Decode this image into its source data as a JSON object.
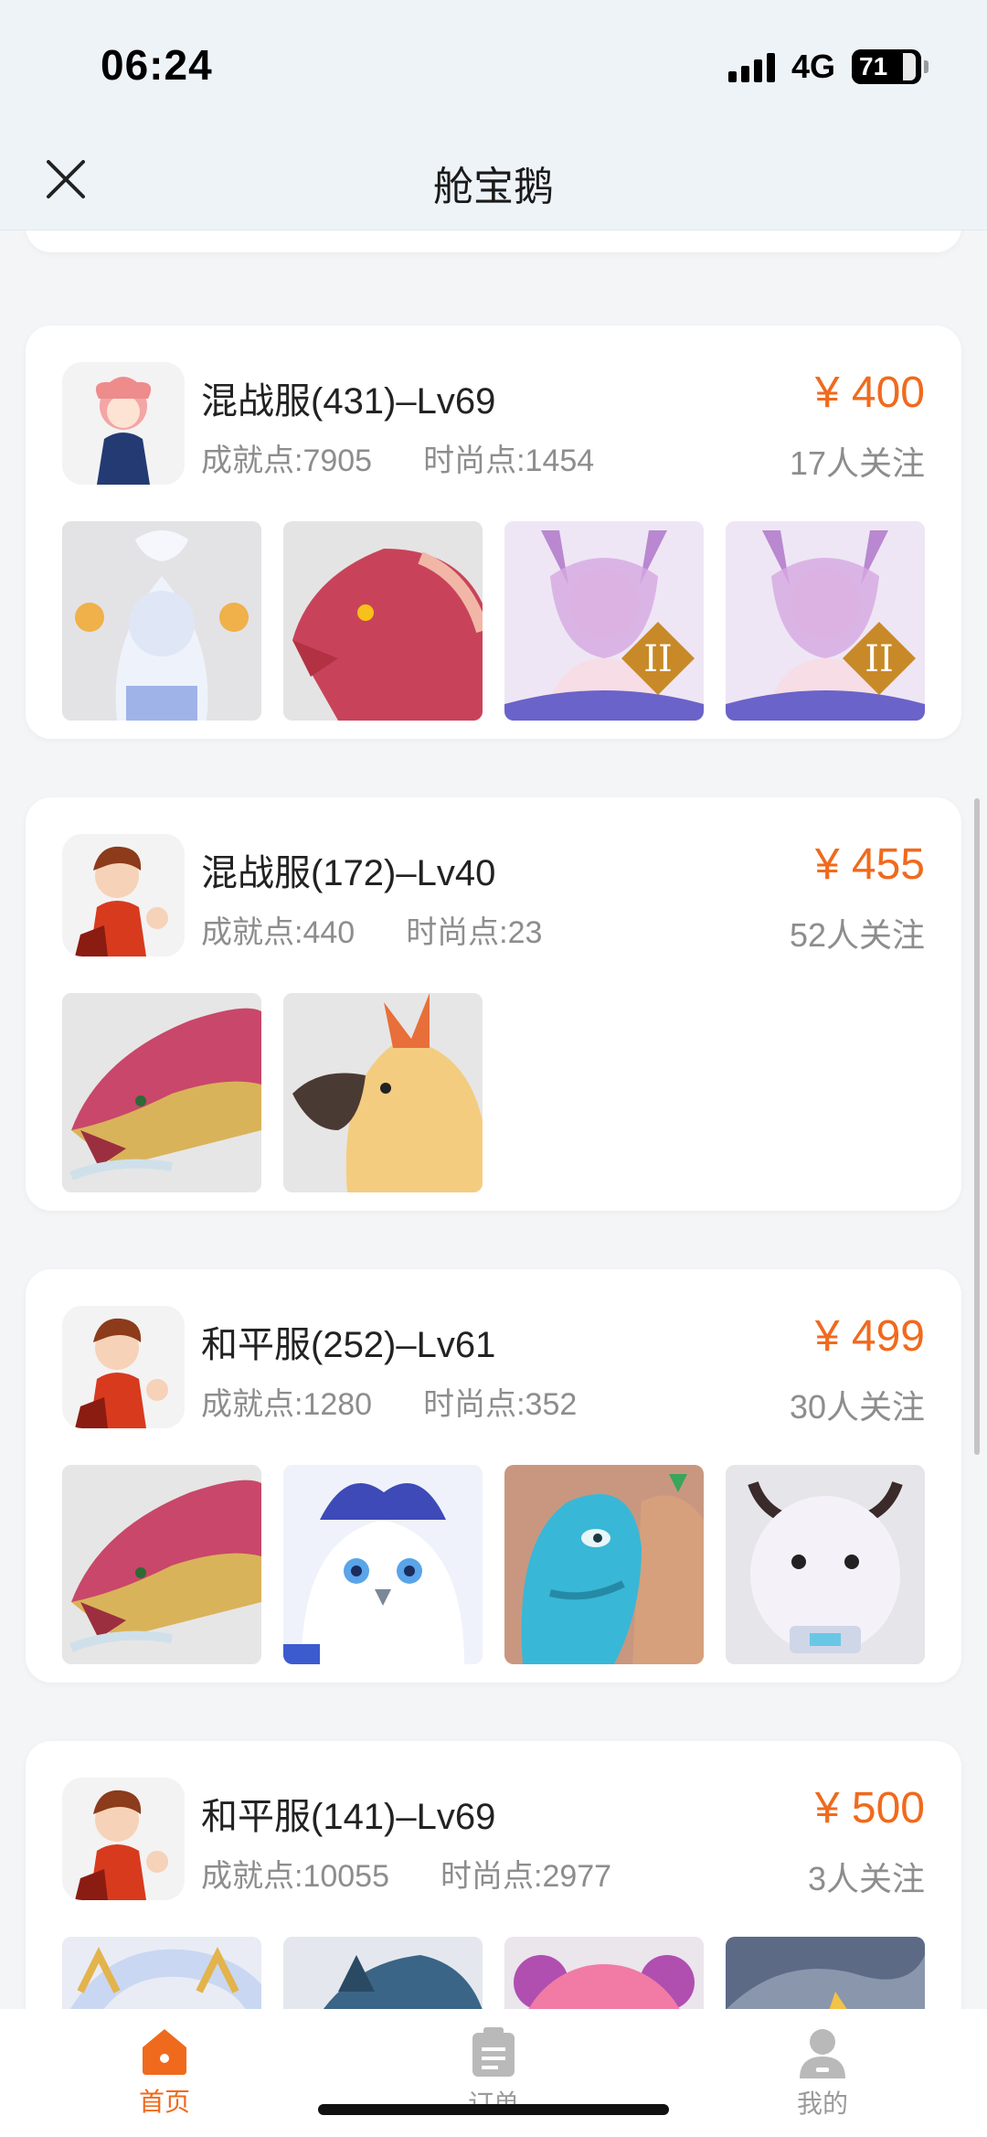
{
  "status": {
    "time": "06:24",
    "network": "4G",
    "battery": "71",
    "battery_level": 0.71
  },
  "nav": {
    "title": "舱宝鹅"
  },
  "listings": [
    {
      "server": "混战服(431)–Lv69",
      "achievement": "成就点:7905",
      "fashion": "时尚点:1454",
      "price": "¥ 400",
      "followers": "17人关注"
    },
    {
      "server": "混战服(172)–Lv40",
      "achievement": "成就点:440",
      "fashion": "时尚点:23",
      "price": "¥ 455",
      "followers": "52人关注"
    },
    {
      "server": "和平服(252)–Lv61",
      "achievement": "成就点:1280",
      "fashion": "时尚点:352",
      "price": "¥ 499",
      "followers": "30人关注"
    },
    {
      "server": "和平服(141)–Lv69",
      "achievement": "成就点:10055",
      "fashion": "时尚点:2977",
      "price": "¥ 500",
      "followers": "3人关注"
    }
  ],
  "tabs": [
    {
      "label": "首页",
      "icon": "home-icon",
      "active": true
    },
    {
      "label": "订单",
      "icon": "order-icon",
      "active": false
    },
    {
      "label": "我的",
      "icon": "profile-icon",
      "active": false
    }
  ],
  "colors": {
    "accent": "#f06a1d",
    "muted": "#8d8d8d",
    "background": "#f4f5f7"
  }
}
